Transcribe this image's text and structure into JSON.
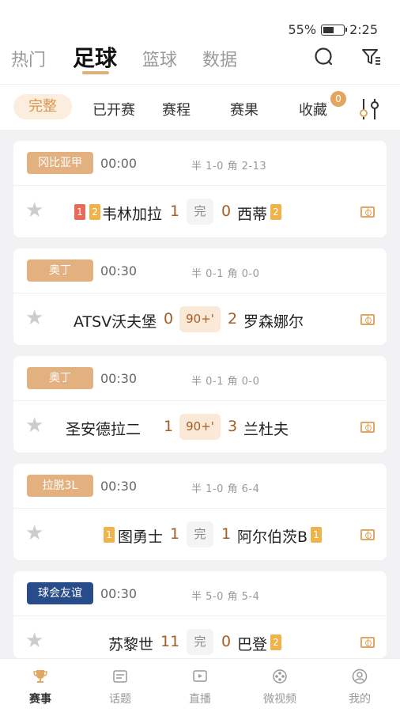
{
  "status_bar": {
    "battery": "55%",
    "battery_level": 0.55,
    "time": "2:25"
  },
  "top_nav": {
    "tabs": [
      {
        "label": "热门"
      },
      {
        "label": "足球",
        "active": true
      },
      {
        "label": "篮球"
      },
      {
        "label": "数据"
      }
    ],
    "icons": [
      "search-icon",
      "filter-icon"
    ]
  },
  "filter_bar": {
    "items": [
      "完整",
      "已开赛",
      "赛程",
      "赛果",
      "收藏"
    ],
    "active": "完整",
    "fav_count": "0"
  },
  "matches": [
    {
      "league": "冈比亚甲",
      "league_color": "#e3b17f",
      "time": "00:00",
      "stats": "半 1-0  角 2-13",
      "home": "韦林加拉",
      "home_score": "1",
      "status": "完",
      "away_score": "0",
      "away": "西蒂",
      "home_cards": [
        {
          "type": "red",
          "count": "1"
        },
        {
          "type": "yellow",
          "count": "2"
        }
      ],
      "away_cards": [
        {
          "type": "yellow",
          "count": "2"
        }
      ]
    },
    {
      "league": "奥丁",
      "league_color": "#e3b17f",
      "time": "00:30",
      "stats": "半 0-1  角 0-0",
      "home": "ATSV沃夫堡",
      "home_score": "0",
      "status": "90+'",
      "away_score": "2",
      "away": "罗森娜尔"
    },
    {
      "league": "奥丁",
      "league_color": "#e3b17f",
      "time": "00:30",
      "stats": "半 0-1  角 0-0",
      "home": "圣安德拉二",
      "home_score": "1",
      "status": "90+'",
      "away_score": "3",
      "away": "兰杜夫"
    },
    {
      "league": "拉脱3L",
      "league_color": "#e3b17f",
      "time": "00:30",
      "stats": "半 1-0  角 6-4",
      "home": "图勇士",
      "home_score": "1",
      "status": "完",
      "away_score": "1",
      "away": "阿尔伯茨B",
      "home_cards": [
        {
          "type": "yellow",
          "count": "1"
        }
      ],
      "away_cards": [
        {
          "type": "yellow",
          "count": "1"
        }
      ]
    },
    {
      "league": "球会友谊",
      "league_color": "#284c8a",
      "time": "00:30",
      "stats": "半 5-0  角 5-4",
      "home": "苏黎世",
      "home_score": "11",
      "status": "完",
      "away_score": "0",
      "away": "巴登",
      "away_cards": [
        {
          "type": "yellow",
          "count": "2"
        }
      ]
    }
  ],
  "bottom_nav": [
    {
      "label": "赛事",
      "icon": "trophy-icon",
      "active": true
    },
    {
      "label": "话题",
      "icon": "topic-icon"
    },
    {
      "label": "直播",
      "icon": "live-icon"
    },
    {
      "label": "微视频",
      "icon": "video-icon"
    },
    {
      "label": "我的",
      "icon": "profile-icon"
    }
  ]
}
